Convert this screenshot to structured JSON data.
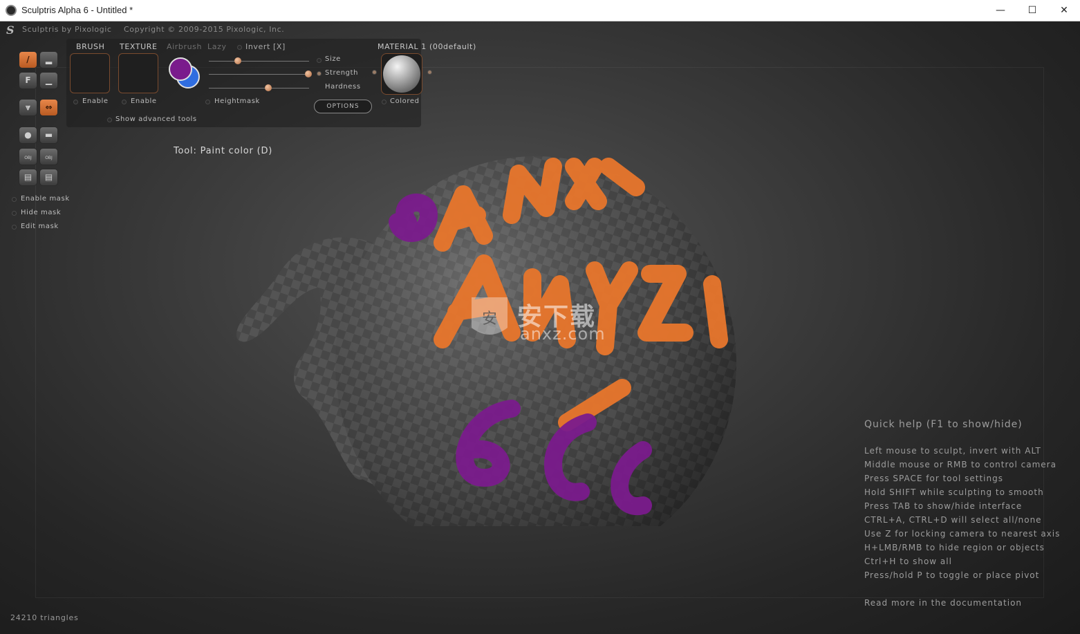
{
  "window": {
    "title": "Sculptris Alpha 6 - Untitled *",
    "controls": {
      "minimize": "—",
      "maximize": "☐",
      "close": "✕"
    }
  },
  "header": {
    "app_name": "Sculptris by Pixologic",
    "copyright": "Copyright © 2009-2015 Pixologic, Inc."
  },
  "toolbar": {
    "brush_label": "BRUSH",
    "texture_label": "TEXTURE",
    "airbrush_label": "Airbrush",
    "lazy_label": "Lazy",
    "invert_label": "Invert [X]",
    "brush_enable": "Enable",
    "texture_enable": "Enable",
    "heightmask_label": "Heightmask",
    "show_advanced": "Show advanced tools",
    "options_label": "OPTIONS",
    "sliders": [
      {
        "label": "Size",
        "value": 0.3
      },
      {
        "label": "Strength",
        "value": 1.0
      },
      {
        "label": "Hardness",
        "value": 0.6
      }
    ],
    "primary_color": "#7a1b8c",
    "secondary_color": "#2f6de0",
    "material_title": "MATERIAL 1 (00default)",
    "material_colored": "Colored",
    "tool_buttons": {
      "paint": "/",
      "flatten": "F",
      "obj_import": "OBJ",
      "obj_export": "OBJ"
    }
  },
  "mask": {
    "enable": "Enable mask",
    "hide": "Hide mask",
    "edit": "Edit mask"
  },
  "status": {
    "tool_caption": "Tool: Paint color (D)",
    "triangles": "24210 triangles"
  },
  "quick_help": {
    "title": "Quick help (F1 to show/hide)",
    "lines": [
      "Left mouse to sculpt, invert with ALT",
      "Middle mouse or RMB to control camera",
      "Press SPACE for tool settings",
      "Hold SHIFT while sculpting to smooth",
      "Press TAB to show/hide interface",
      "CTRL+A, CTRL+D will select all/none",
      "Use Z for locking camera to nearest axis",
      "H+LMB/RMB to hide region or objects",
      "Ctrl+H to show all",
      "Press/hold P to toggle or place pivot"
    ],
    "footer": "Read more in the documentation"
  },
  "watermark": {
    "cn": "安下载",
    "en": "anxz.com"
  },
  "colors": {
    "accent_orange": "#e8874a",
    "paint_orange": "#e8762c",
    "paint_purple": "#7a1b8c"
  }
}
